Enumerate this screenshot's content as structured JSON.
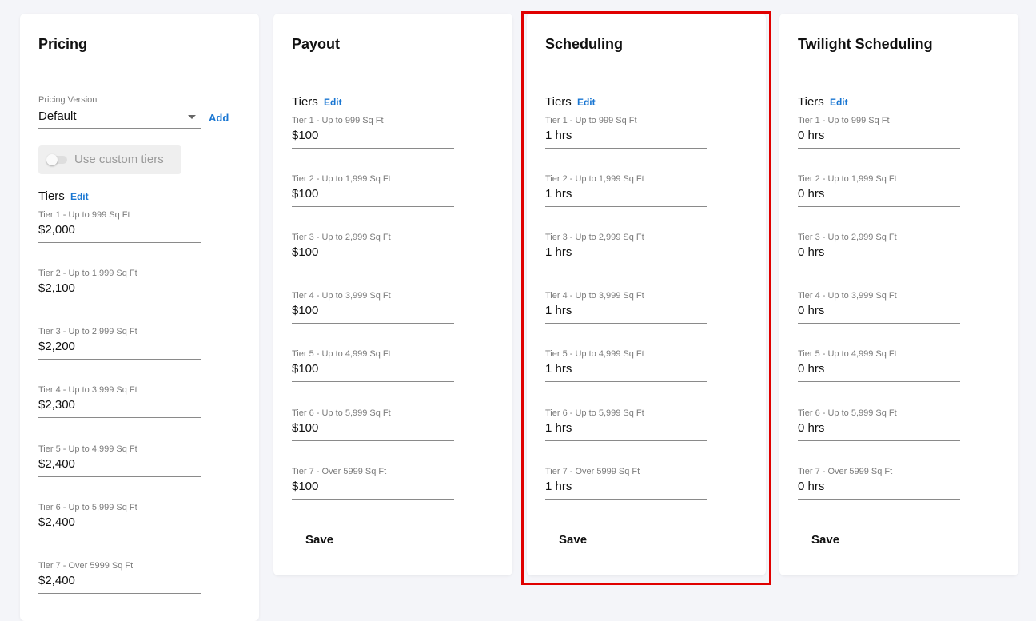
{
  "pricing": {
    "title": "Pricing",
    "version_label": "Pricing Version",
    "version_value": "Default",
    "add_label": "Add",
    "custom_tiers_label": "Use custom tiers",
    "custom_tiers_enabled": false,
    "tiers_label": "Tiers",
    "edit_label": "Edit",
    "tiers": [
      {
        "label": "Tier 1 - Up to 999 Sq Ft",
        "value": "$2,000"
      },
      {
        "label": "Tier 2 - Up to 1,999 Sq Ft",
        "value": "$2,100"
      },
      {
        "label": "Tier 3 - Up to 2,999 Sq Ft",
        "value": "$2,200"
      },
      {
        "label": "Tier 4 - Up to 3,999 Sq Ft",
        "value": "$2,300"
      },
      {
        "label": "Tier 5 - Up to 4,999 Sq Ft",
        "value": "$2,400"
      },
      {
        "label": "Tier 6 - Up to 5,999 Sq Ft",
        "value": "$2,400"
      },
      {
        "label": "Tier 7 - Over 5999 Sq Ft",
        "value": "$2,400"
      }
    ]
  },
  "payout": {
    "title": "Payout",
    "tiers_label": "Tiers",
    "edit_label": "Edit",
    "save_label": "Save",
    "tiers": [
      {
        "label": "Tier 1 - Up to 999 Sq Ft",
        "value": "$100"
      },
      {
        "label": "Tier 2 - Up to 1,999 Sq Ft",
        "value": "$100"
      },
      {
        "label": "Tier 3 - Up to 2,999 Sq Ft",
        "value": "$100"
      },
      {
        "label": "Tier 4 - Up to 3,999 Sq Ft",
        "value": "$100"
      },
      {
        "label": "Tier 5 - Up to 4,999 Sq Ft",
        "value": "$100"
      },
      {
        "label": "Tier 6 - Up to 5,999 Sq Ft",
        "value": "$100"
      },
      {
        "label": "Tier 7 - Over 5999 Sq Ft",
        "value": "$100"
      }
    ]
  },
  "scheduling": {
    "title": "Scheduling",
    "tiers_label": "Tiers",
    "edit_label": "Edit",
    "save_label": "Save",
    "tiers": [
      {
        "label": "Tier 1 - Up to 999 Sq Ft",
        "value": "1 hrs"
      },
      {
        "label": "Tier 2 - Up to 1,999 Sq Ft",
        "value": "1 hrs"
      },
      {
        "label": "Tier 3 - Up to 2,999 Sq Ft",
        "value": "1 hrs"
      },
      {
        "label": "Tier 4 - Up to 3,999 Sq Ft",
        "value": "1 hrs"
      },
      {
        "label": "Tier 5 - Up to 4,999 Sq Ft",
        "value": "1 hrs"
      },
      {
        "label": "Tier 6 - Up to 5,999 Sq Ft",
        "value": "1 hrs"
      },
      {
        "label": "Tier 7 - Over 5999 Sq Ft",
        "value": "1 hrs"
      }
    ]
  },
  "twilight": {
    "title": "Twilight Scheduling",
    "tiers_label": "Tiers",
    "edit_label": "Edit",
    "save_label": "Save",
    "tiers": [
      {
        "label": "Tier 1 - Up to 999 Sq Ft",
        "value": "0 hrs"
      },
      {
        "label": "Tier 2 - Up to 1,999 Sq Ft",
        "value": "0 hrs"
      },
      {
        "label": "Tier 3 - Up to 2,999 Sq Ft",
        "value": "0 hrs"
      },
      {
        "label": "Tier 4 - Up to 3,999 Sq Ft",
        "value": "0 hrs"
      },
      {
        "label": "Tier 5 - Up to 4,999 Sq Ft",
        "value": "0 hrs"
      },
      {
        "label": "Tier 6 - Up to 5,999 Sq Ft",
        "value": "0 hrs"
      },
      {
        "label": "Tier 7 - Over 5999 Sq Ft",
        "value": "0 hrs"
      }
    ]
  },
  "colors": {
    "accent": "#1976d2",
    "highlight": "#e00000",
    "background": "#f4f5f9"
  }
}
